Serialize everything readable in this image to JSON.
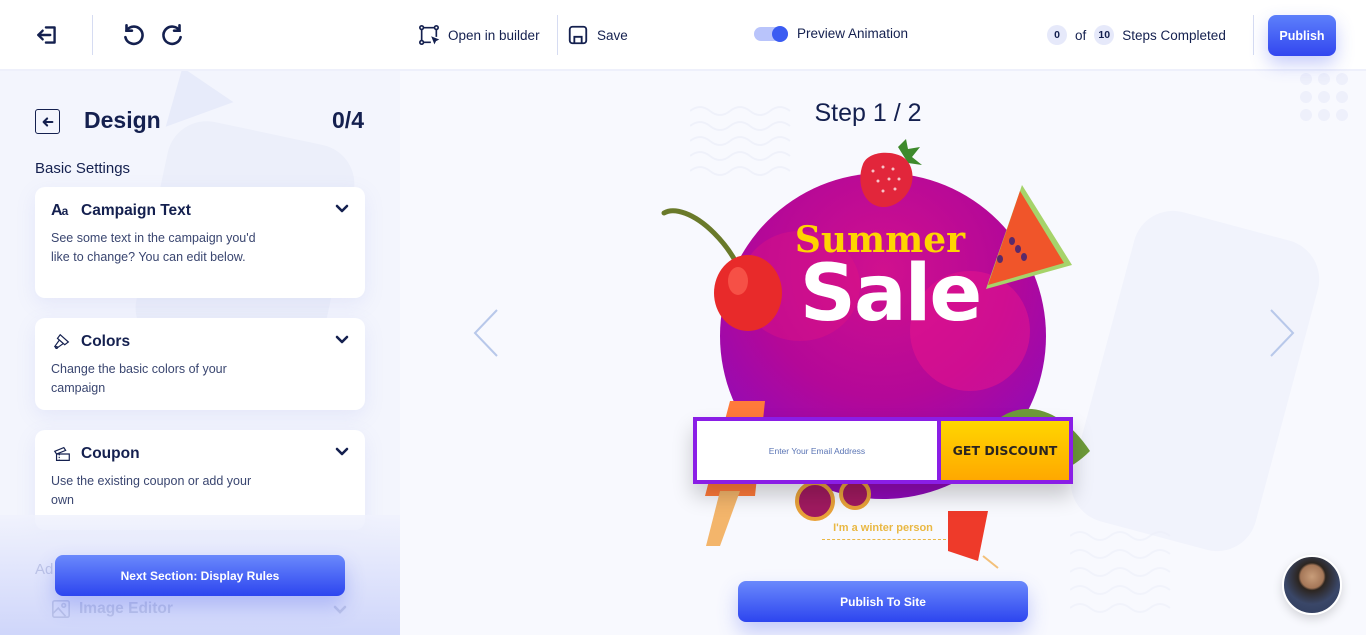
{
  "topbar": {
    "open_in_builder_label": "Open in builder",
    "save_label": "Save",
    "preview_animation_label": "Preview Animation",
    "preview_animation_on": true,
    "steps_completed": "0",
    "steps_of": "of",
    "steps_total": "10",
    "steps_label": "Steps Completed",
    "publish_label": "Publish"
  },
  "sidebar": {
    "title": "Design",
    "progress": "0/4",
    "section_label": "Basic Settings",
    "cards": [
      {
        "icon": "font-size-icon",
        "title": "Campaign Text",
        "description": "See some text in the campaign you'd like to change? You can edit below."
      },
      {
        "icon": "paint-brush-icon",
        "title": "Colors",
        "description": "Change the basic colors of your campaign"
      },
      {
        "icon": "coupon-icon",
        "title": "Coupon",
        "description": "Use the existing coupon or add your own"
      }
    ],
    "advanced_label_partial": "Ad",
    "faded_item": {
      "icon": "image-icon",
      "title": "Image Editor"
    },
    "next_section_label": "Next Section: Display Rules"
  },
  "main": {
    "step_title": "Step 1 / 2",
    "campaign": {
      "headline_top": "Summer",
      "headline_main": "Sale",
      "email_placeholder": "Enter Your Email Address",
      "cta_label": "GET DISCOUNT",
      "decline_link": "I'm a winter person"
    },
    "publish_to_site_label": "Publish To Site"
  },
  "colors": {
    "accent": "#3b5cf2",
    "navy_text": "#14204f",
    "campaign_magenta": "#c40a94",
    "campaign_purple": "#7b0ccb",
    "cta_yellow": "#ffc400"
  }
}
